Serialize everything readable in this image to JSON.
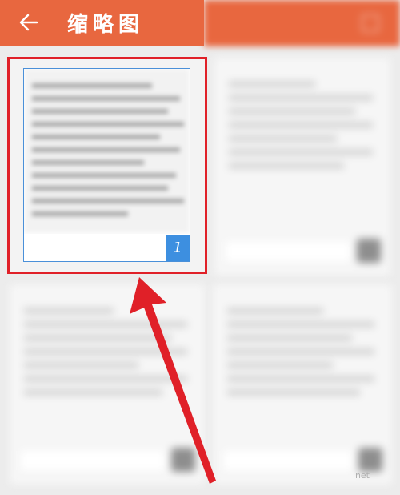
{
  "header": {
    "title": "缩略图",
    "back_icon": "arrow-left-icon",
    "background": "#e8673f"
  },
  "thumbnails": [
    {
      "page_label": "1",
      "selected": true,
      "badge_color": "#3d8fe0"
    }
  ],
  "annotation": {
    "highlight_color": "#e02028",
    "arrow_color": "#e02028"
  },
  "watermark": "net"
}
